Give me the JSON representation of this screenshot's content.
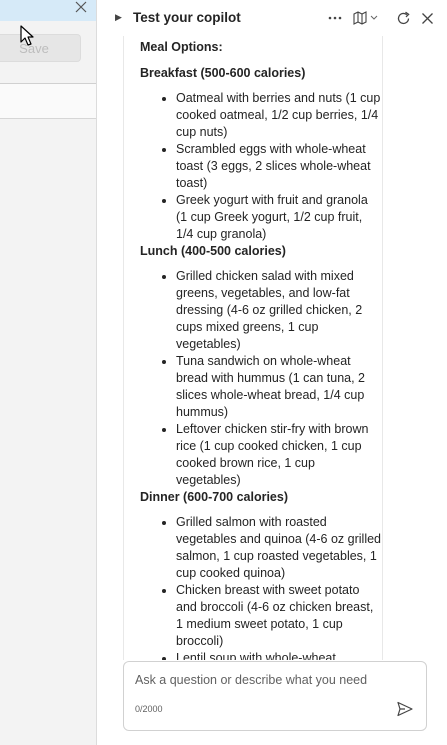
{
  "left_panel": {
    "save_label": "Save"
  },
  "header": {
    "title": "Test your copilot"
  },
  "chat": {
    "meal_options": "Meal Options:",
    "sections": [
      {
        "heading": "Breakfast (500-600 calories)",
        "items": [
          "Oatmeal with berries and nuts (1 cup cooked oatmeal, 1/2 cup berries, 1/4 cup nuts)",
          "Scrambled eggs with whole-wheat toast (3 eggs, 2 slices whole-wheat toast)",
          "Greek yogurt with fruit and granola (1 cup Greek yogurt, 1/2 cup fruit, 1/4 cup granola)"
        ]
      },
      {
        "heading": "Lunch (400-500 calories)",
        "items": [
          "Grilled chicken salad with mixed greens, vegetables, and low-fat dressing (4-6 oz grilled chicken, 2 cups mixed greens, 1 cup vegetables)",
          "Tuna sandwich on whole-wheat bread with hummus (1 can tuna, 2 slices whole-wheat bread, 1/4 cup hummus)",
          "Leftover chicken stir-fry with brown rice (1 cup cooked chicken, 1 cup cooked brown rice, 1 cup vegetables)"
        ]
      },
      {
        "heading": "Dinner (600-700 calories)",
        "items": [
          "Grilled salmon with roasted vegetables and quinoa (4-6 oz grilled salmon, 1 cup roasted vegetables, 1 cup cooked quinoa)",
          "Chicken breast with sweet potato and broccoli (4-6 oz chicken breast, 1 medium sweet potato, 1 cup broccoli)",
          "Lentil soup with whole-wheat"
        ]
      }
    ]
  },
  "input": {
    "placeholder": "Ask a question or describe what you need",
    "counter": "0/2000"
  },
  "icons": {
    "close": "close-icon",
    "more": "more-icon",
    "map": "map-icon",
    "refresh": "refresh-icon",
    "send": "send-icon"
  }
}
